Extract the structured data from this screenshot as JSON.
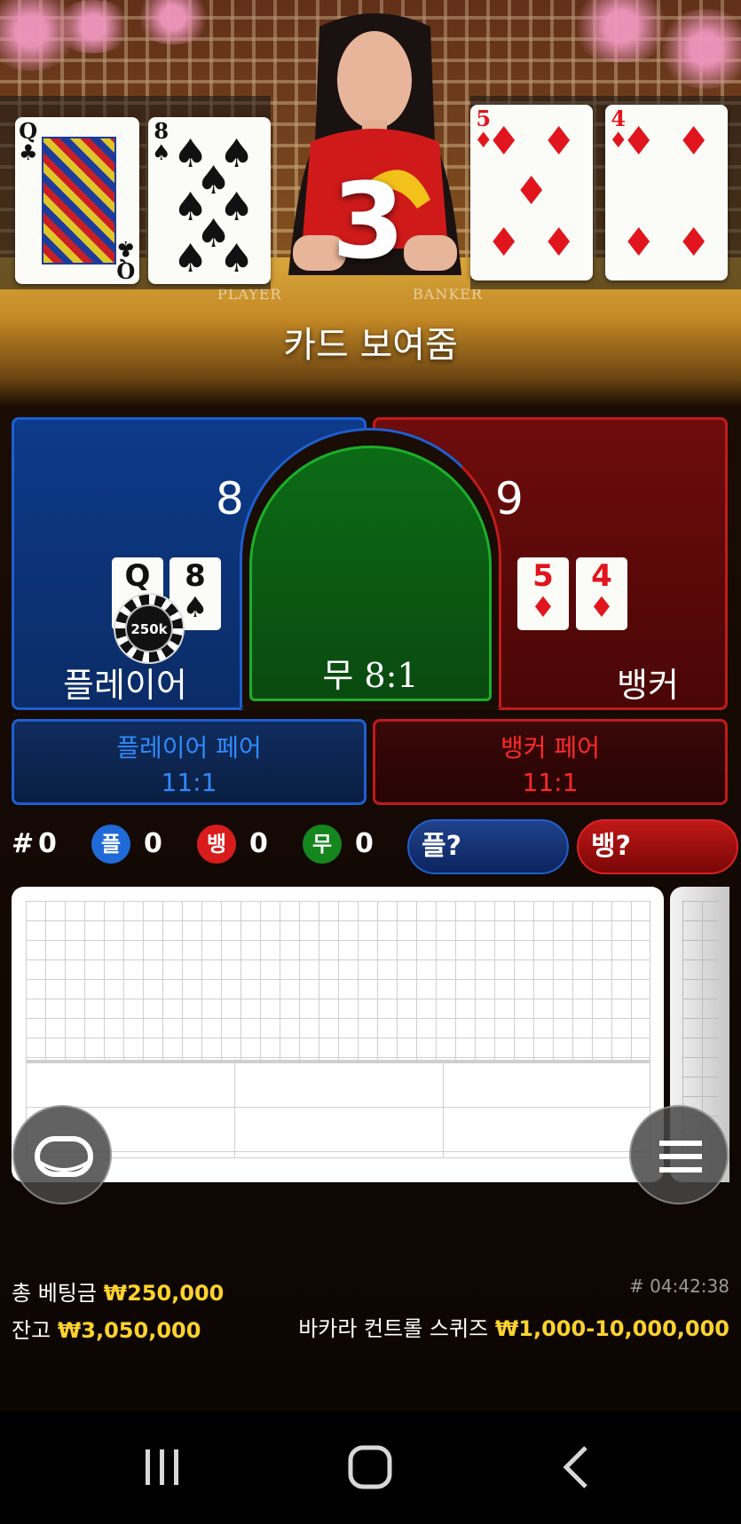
{
  "video": {
    "countdown": "3",
    "status": "카드 보여줌",
    "player_cards": [
      {
        "rank": "Q",
        "suit": "♣",
        "color": "black"
      },
      {
        "rank": "8",
        "suit": "♠",
        "color": "black"
      }
    ],
    "banker_cards": [
      {
        "rank": "5",
        "suit": "♦",
        "color": "red"
      },
      {
        "rank": "4",
        "suit": "♦",
        "color": "red"
      }
    ],
    "table_labels": {
      "player": "PLAYER",
      "banker": "BANKER"
    }
  },
  "betting": {
    "player": {
      "label": "플레이어",
      "score": "8",
      "cards": [
        {
          "rank": "Q",
          "suit": "♣"
        },
        {
          "rank": "8",
          "suit": "♠"
        }
      ]
    },
    "banker": {
      "label": "뱅커",
      "score": "9",
      "cards": [
        {
          "rank": "5",
          "suit": "♦"
        },
        {
          "rank": "4",
          "suit": "♦"
        }
      ]
    },
    "tie": {
      "label": "무 8:1"
    },
    "player_pair": {
      "label": "플레이어 페어",
      "odds": "11:1"
    },
    "banker_pair": {
      "label": "뱅커 페어",
      "odds": "11:1"
    },
    "chip": {
      "value": "250k"
    }
  },
  "stats": {
    "round_prefix": "#",
    "round_count": "0",
    "player_badge": "플",
    "player_count": "0",
    "banker_badge": "뱅",
    "banker_count": "0",
    "tie_badge": "무",
    "tie_count": "0",
    "player_ask": "플?",
    "banker_ask": "뱅?"
  },
  "footer": {
    "total_bet_label": "총 베팅금",
    "total_bet_value": "₩250,000",
    "balance_label": "잔고",
    "balance_value": "₩3,050,000",
    "clock": "# 04:42:38",
    "table_name": "바카라 컨트롤 스퀴즈",
    "limits": "₩1,000-10,000,000"
  },
  "colors": {
    "player": "#1e5fd1",
    "banker": "#c31a1a",
    "tie": "#1bb02a",
    "gold": "#ffd22e"
  },
  "icons": {
    "table_view": "table-oval-icon",
    "menu": "hamburger-menu-icon",
    "nav_recents": "recent-apps-icon",
    "nav_home": "home-icon",
    "nav_back": "back-icon"
  }
}
